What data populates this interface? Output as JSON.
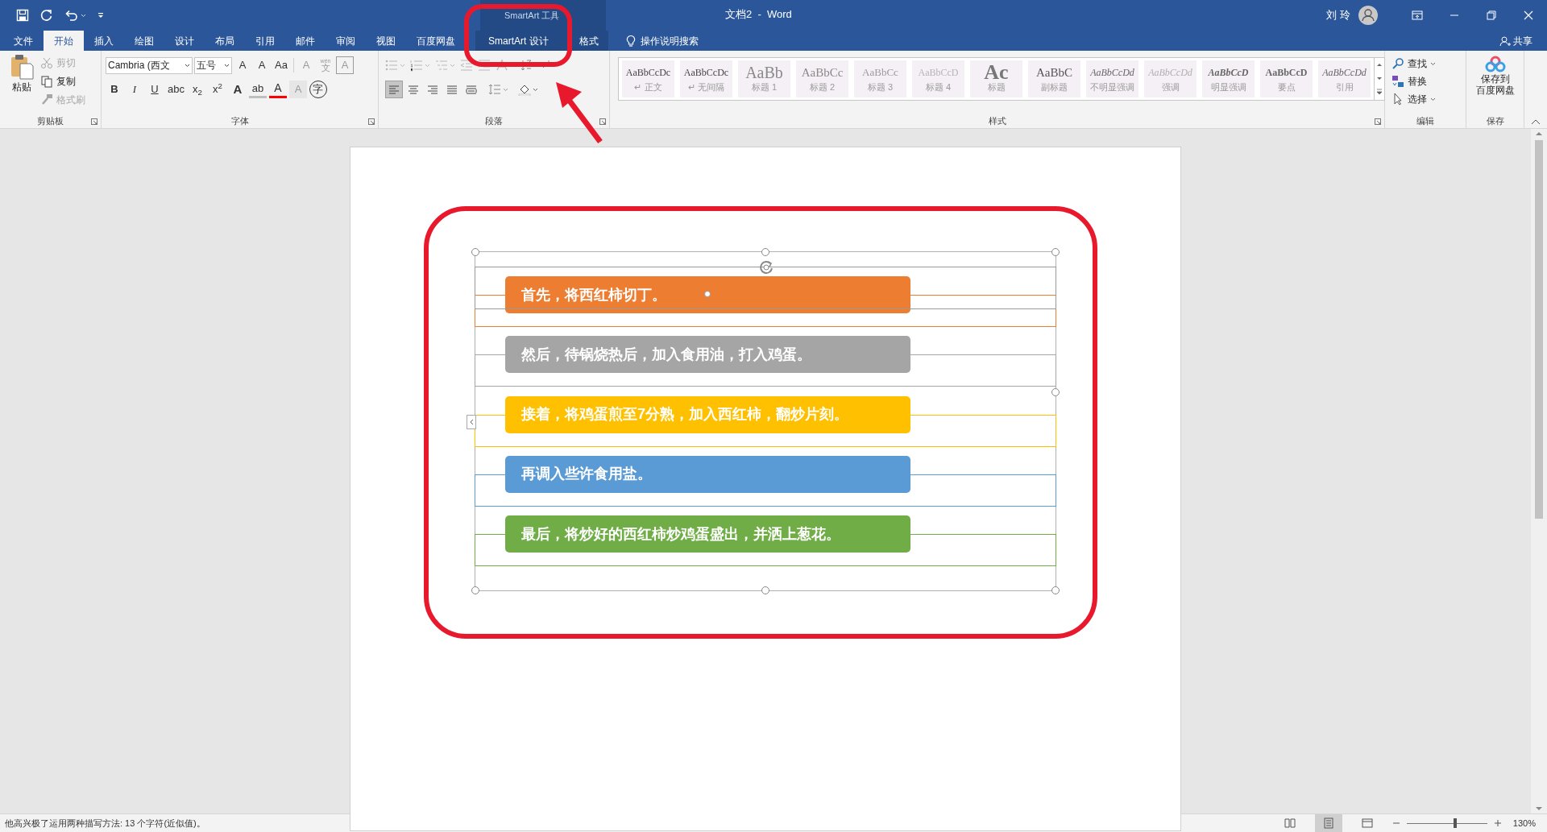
{
  "window": {
    "title": "文档2  -  Word",
    "contextual_label": "SmartArt 工具",
    "user": "刘 玲"
  },
  "tabs": [
    {
      "label": "文件",
      "selected": false,
      "kind": "normal"
    },
    {
      "label": "开始",
      "selected": true,
      "kind": "normal"
    },
    {
      "label": "插入",
      "selected": false,
      "kind": "normal"
    },
    {
      "label": "绘图",
      "selected": false,
      "kind": "normal"
    },
    {
      "label": "设计",
      "selected": false,
      "kind": "normal"
    },
    {
      "label": "布局",
      "selected": false,
      "kind": "normal"
    },
    {
      "label": "引用",
      "selected": false,
      "kind": "normal"
    },
    {
      "label": "邮件",
      "selected": false,
      "kind": "normal"
    },
    {
      "label": "审阅",
      "selected": false,
      "kind": "normal"
    },
    {
      "label": "视图",
      "selected": false,
      "kind": "normal"
    },
    {
      "label": "百度网盘",
      "selected": false,
      "kind": "normal"
    },
    {
      "label": "SmartArt 设计",
      "selected": false,
      "kind": "contextual"
    },
    {
      "label": "格式",
      "selected": false,
      "kind": "contextual"
    }
  ],
  "tell_me": "操作说明搜索",
  "share": "共享",
  "clipboard": {
    "paste": "粘贴",
    "label": "剪贴板",
    "actions": [
      {
        "label": "剪切",
        "kind": "cut",
        "disabled": true
      },
      {
        "label": "复制",
        "kind": "copy",
        "disabled": false
      },
      {
        "label": "格式刷",
        "kind": "brush",
        "disabled": true
      }
    ]
  },
  "font": {
    "name": "Cambria (西文",
    "size": "五号",
    "label": "字体",
    "row1": [
      {
        "glyph": "A",
        "kind": "grow",
        "disabled": false
      },
      {
        "glyph": "A",
        "kind": "shrink",
        "disabled": false
      },
      {
        "glyph": "Aa",
        "kind": "case",
        "disabled": false
      },
      {
        "glyph": "A",
        "kind": "clear",
        "disabled": true
      },
      {
        "glyph": "文",
        "ruby": "wén",
        "kind": "phonetic",
        "disabled": true
      },
      {
        "glyph": "A",
        "kind": "border",
        "disabled": true
      }
    ],
    "row2": [
      {
        "glyph": "B",
        "kind": "bold",
        "disabled": false
      },
      {
        "glyph": "I",
        "kind": "italic",
        "disabled": false
      },
      {
        "glyph": "U",
        "kind": "underline",
        "disabled": false
      },
      {
        "glyph": "abc",
        "kind": "strike",
        "disabled": false
      },
      {
        "glyph": "x$_{2}$",
        "kind": "plain",
        "disabled": false
      },
      {
        "glyph": "x$^{2}$",
        "kind": "plain",
        "disabled": false
      },
      {
        "glyph": "A",
        "kind": "effects",
        "disabled": false
      },
      {
        "glyph": "ab",
        "kind": "highlight",
        "disabled": false
      },
      {
        "glyph": "A",
        "kind": "color",
        "disabled": false
      },
      {
        "glyph": "A",
        "kind": "shading",
        "disabled": true
      },
      {
        "glyph": "字",
        "kind": "enclose",
        "disabled": false
      }
    ]
  },
  "paragraph": {
    "label": "段落",
    "list_tools_disabled": true,
    "alignments": [
      {
        "kind": "left",
        "selected": true
      },
      {
        "kind": "center",
        "selected": false
      },
      {
        "kind": "right",
        "selected": false
      },
      {
        "kind": "justify",
        "selected": false
      },
      {
        "kind": "distributed",
        "selected": false
      }
    ]
  },
  "styles": {
    "label": "样式",
    "items": [
      {
        "preview": "AaBbCcDc",
        "name": "正文",
        "mark": "↵",
        "kind": "normal"
      },
      {
        "preview": "AaBbCcDc",
        "name": "无间隔",
        "mark": "↵",
        "kind": "normal"
      },
      {
        "preview": "AaBb",
        "name": "标题 1",
        "kind": "heading1"
      },
      {
        "preview": "AaBbCc",
        "name": "标题 2",
        "kind": "heading2"
      },
      {
        "preview": "AaBbCc",
        "name": "标题 3",
        "kind": "heading3"
      },
      {
        "preview": "AaBbCcD",
        "name": "标题 4",
        "kind": "heading4"
      },
      {
        "preview": "Ac",
        "name": "标题",
        "kind": "title"
      },
      {
        "preview": "AaBbC",
        "name": "副标题",
        "kind": "subtitle"
      },
      {
        "preview": "AaBbCcDd",
        "name": "不明显强调",
        "kind": "italic"
      },
      {
        "preview": "AaBbCcDd",
        "name": "强调",
        "kind": "italic_light"
      },
      {
        "preview": "AaBbCcD",
        "name": "明显强调",
        "kind": "bold_italic"
      },
      {
        "preview": "AaBbCcD",
        "name": "要点",
        "kind": "bold"
      },
      {
        "preview": "AaBbCcDd",
        "name": "引用",
        "kind": "italic"
      }
    ]
  },
  "editing": {
    "label": "编辑",
    "items": [
      {
        "label": "查找",
        "kind": "find",
        "dropdown": true
      },
      {
        "label": "替换",
        "kind": "replace",
        "dropdown": false
      },
      {
        "label": "选择",
        "kind": "select",
        "dropdown": true
      }
    ]
  },
  "save": {
    "lines": [
      "保存到",
      "百度网盘"
    ],
    "label": "保存"
  },
  "smartart": {
    "items": [
      {
        "text": "首先，将西红柿切丁。",
        "color": "#ed7d31",
        "selected": true
      },
      {
        "text": "然后，待锅烧热后，加入食用油，打入鸡蛋。",
        "color": "#a5a5a5",
        "selected": false
      },
      {
        "text": "接着，将鸡蛋煎至7分熟，加入西红柿，翻炒片刻。",
        "color": "#ffc000",
        "selected": false
      },
      {
        "text": "再调入些许食用盐。",
        "color": "#5b9bd5",
        "selected": false
      },
      {
        "text": "最后，将炒好的西红柿炒鸡蛋盛出，并洒上葱花。",
        "color": "#70ad47",
        "selected": false
      }
    ]
  },
  "status_bar": {
    "text": "他高兴极了运用两种描写方法: 13 个字符(近似值)。",
    "views": [
      {
        "kind": "read",
        "selected": false
      },
      {
        "kind": "print",
        "selected": true
      },
      {
        "kind": "web",
        "selected": false
      }
    ],
    "zoom": {
      "level": 0.6,
      "reading": "130%"
    }
  }
}
